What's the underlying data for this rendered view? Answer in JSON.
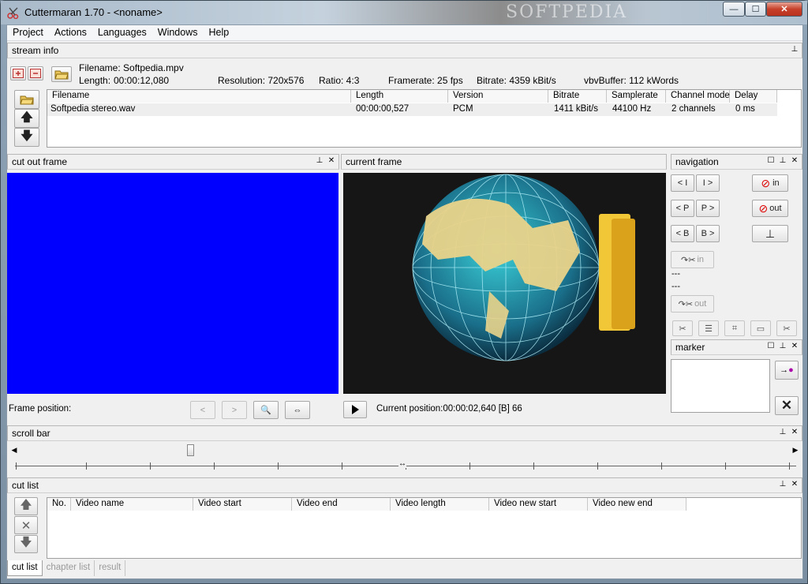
{
  "window": {
    "title": "Cuttermaran 1.70 - <noname>",
    "watermark": "SOFTPEDIA",
    "min_glyph": "—",
    "max_glyph": "☐",
    "close_glyph": "✕"
  },
  "menu": [
    "Project",
    "Actions",
    "Languages",
    "Windows",
    "Help"
  ],
  "stream_info": {
    "title": "stream info",
    "filename_label": "Filename: Softpedia.mpv",
    "length_label": "Length:",
    "length_value": "00:00:12,080",
    "resolution": "Resolution:  720x576",
    "ratio": "Ratio:  4:3",
    "framerate": "Framerate: 25 fps",
    "bitrate": "Bitrate:  4359 kBit/s",
    "vbv": "vbvBuffer:  112 kWords",
    "audio_columns": [
      "Filename",
      "Length",
      "Version",
      "Bitrate",
      "Samplerate",
      "Channel mode",
      "Delay"
    ],
    "audio_rows": [
      [
        "Softpedia stereo.wav",
        "00:00:00,527",
        "PCM",
        "1411 kBit/s",
        "44100 Hz",
        "2 channels",
        "0 ms"
      ]
    ]
  },
  "cut_out_frame": {
    "title": "cut out frame",
    "frame_position_label": "Frame position:",
    "prev_label": "<",
    "next_label": ">"
  },
  "current_frame": {
    "title": "current frame",
    "position_text": "Current position:00:00:02,640  [B] 66"
  },
  "navigation": {
    "title": "navigation",
    "btn_prev_i": "< I",
    "btn_next_i": "I >",
    "btn_prev_p": "< P",
    "btn_next_p": "P >",
    "btn_prev_b": "< B",
    "btn_next_b": "B >",
    "btn_in": "in",
    "btn_out": "out",
    "cut_in": "in",
    "cut_out": "out",
    "dash1": "---",
    "dash2": "---"
  },
  "marker": {
    "title": "marker"
  },
  "scroll_bar": {
    "title": "scroll bar"
  },
  "cut_list": {
    "title": "cut list",
    "columns": [
      "No.",
      "Video name",
      "Video start",
      "Video end",
      "Video length",
      "Video new start",
      "Video new end"
    ],
    "tabs": [
      "cut list",
      "chapter list",
      "result"
    ]
  },
  "colors": {
    "cut_frame_bg": "#0000ff",
    "frame_bg": "#161616"
  }
}
